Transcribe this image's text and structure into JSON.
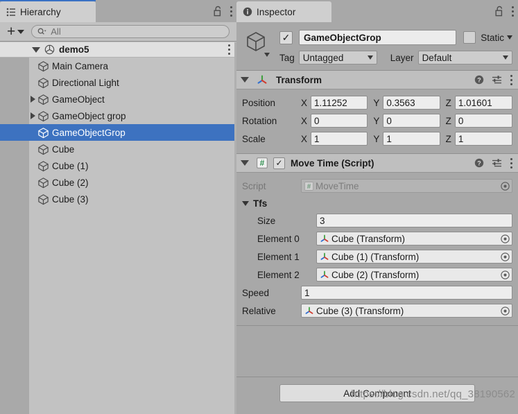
{
  "hierarchy": {
    "tab_label": "Hierarchy",
    "lock_icon": "unlocked-padlock-icon",
    "menu_icon": "kebab-menu-icon",
    "toolbar": {
      "create_label": "+",
      "search_placeholder": "All",
      "search_value": "",
      "search_icon": "search-magnifier-icon"
    },
    "scene": {
      "name": "demo5",
      "expanded": true,
      "icon": "unity-scene-icon"
    },
    "items": [
      {
        "label": "Main Camera",
        "icon": "gameobject-cube-icon",
        "indent": 1,
        "expandable": false,
        "selected": false
      },
      {
        "label": "Directional Light",
        "icon": "gameobject-cube-icon",
        "indent": 1,
        "expandable": false,
        "selected": false
      },
      {
        "label": "GameObject",
        "icon": "gameobject-cube-icon",
        "indent": 1,
        "expandable": true,
        "selected": false
      },
      {
        "label": "GameObject  grop",
        "icon": "gameobject-cube-icon",
        "indent": 1,
        "expandable": true,
        "selected": false
      },
      {
        "label": "GameObjectGrop",
        "icon": "gameobject-cube-icon",
        "indent": 1,
        "expandable": false,
        "selected": true
      },
      {
        "label": "Cube",
        "icon": "gameobject-cube-icon",
        "indent": 1,
        "expandable": false,
        "selected": false
      },
      {
        "label": "Cube (1)",
        "icon": "gameobject-cube-icon",
        "indent": 1,
        "expandable": false,
        "selected": false
      },
      {
        "label": "Cube (2)",
        "icon": "gameobject-cube-icon",
        "indent": 1,
        "expandable": false,
        "selected": false
      },
      {
        "label": "Cube (3)",
        "icon": "gameobject-cube-icon",
        "indent": 1,
        "expandable": false,
        "selected": false
      }
    ]
  },
  "inspector": {
    "tab_label": "Inspector",
    "tab_icon": "info-circle-icon",
    "lock_icon": "unlocked-padlock-icon",
    "menu_icon": "kebab-menu-icon",
    "object": {
      "icon": "gameobject-cube-icon",
      "enabled": true,
      "enabled_mark": "✓",
      "name": "GameObjectGrop",
      "static_label": "Static",
      "static_checked": false,
      "tag_label": "Tag",
      "tag_value": "Untagged",
      "layer_label": "Layer",
      "layer_value": "Default"
    },
    "components": [
      {
        "id": "transform",
        "title": "Transform",
        "icon": "transform-gizmo-icon",
        "expanded": true,
        "has_enable_toggle": false,
        "help_icon": "help-question-icon",
        "preset_icon": "preset-sliders-icon",
        "menu_icon": "kebab-menu-icon",
        "rows": [
          {
            "label": "Position",
            "x": "1.11252",
            "y": "0.3563",
            "z": "1.01601"
          },
          {
            "label": "Rotation",
            "x": "0",
            "y": "0",
            "z": "0"
          },
          {
            "label": "Scale",
            "x": "1",
            "y": "1",
            "z": "1"
          }
        ],
        "axes": [
          "X",
          "Y",
          "Z"
        ]
      },
      {
        "id": "move-time-script",
        "title": "Move Time (Script)",
        "icon": "csharp-script-icon",
        "expanded": true,
        "has_enable_toggle": true,
        "enabled": true,
        "enabled_mark": "✓",
        "help_icon": "help-question-icon",
        "preset_icon": "preset-sliders-icon",
        "menu_icon": "kebab-menu-icon",
        "fields": [
          {
            "kind": "object",
            "label": "Script",
            "value": "MoveTime",
            "icon": "csharp-script-icon",
            "disabled": true,
            "indent": 0
          },
          {
            "kind": "foldout",
            "label": "Tfs",
            "expanded": true
          },
          {
            "kind": "number",
            "label": "Size",
            "value": "3",
            "indent": 1
          },
          {
            "kind": "object",
            "label": "Element 0",
            "value": "Cube (Transform)",
            "icon": "transform-gizmo-icon",
            "disabled": false,
            "indent": 1
          },
          {
            "kind": "object",
            "label": "Element 1",
            "value": "Cube (1) (Transform)",
            "icon": "transform-gizmo-icon",
            "disabled": false,
            "indent": 1
          },
          {
            "kind": "object",
            "label": "Element 2",
            "value": "Cube (2) (Transform)",
            "icon": "transform-gizmo-icon",
            "disabled": false,
            "indent": 1
          },
          {
            "kind": "number",
            "label": "Speed",
            "value": "1",
            "indent": 0
          },
          {
            "kind": "object",
            "label": "Relative",
            "value": "Cube (3) (Transform)",
            "icon": "transform-gizmo-icon",
            "disabled": false,
            "indent": 0
          }
        ]
      }
    ],
    "footer": {
      "add_component_label": "Add Component"
    }
  },
  "watermark": {
    "text": "https://blog.csdn.net/qq_38190562"
  },
  "colors": {
    "selection_blue": "#3d72c0",
    "tab_accent": "#3a72c4",
    "panel_bg": "#a8a8a8",
    "hierarchy_bg": "#c2c2c2",
    "field_bg": "#ededed",
    "axis_x": "#d13b2e",
    "axis_y": "#3fa03f",
    "axis_z": "#2f6fd0"
  }
}
